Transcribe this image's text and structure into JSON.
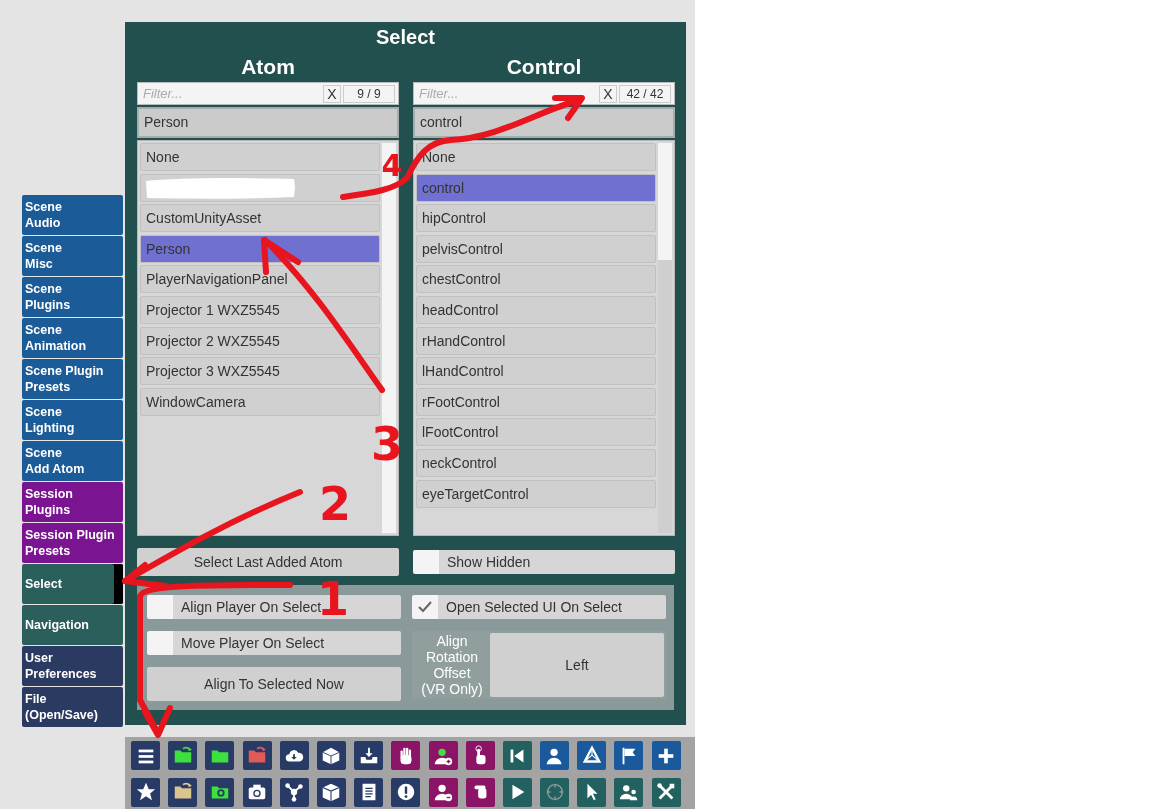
{
  "sidebar": {
    "items": [
      {
        "label": "Scene\nAudio",
        "color": "#1b5b97",
        "selected": false
      },
      {
        "label": "Scene\nMisc",
        "color": "#1b5b97",
        "selected": false
      },
      {
        "label": "Scene\nPlugins",
        "color": "#1b5b97",
        "selected": false
      },
      {
        "label": "Scene\nAnimation",
        "color": "#1b5b97",
        "selected": false
      },
      {
        "label": "Scene Plugin\nPresets",
        "color": "#1b5b97",
        "selected": false
      },
      {
        "label": "Scene\nLighting",
        "color": "#1b5b97",
        "selected": false
      },
      {
        "label": "Scene\nAdd Atom",
        "color": "#1b5b97",
        "selected": false
      },
      {
        "label": "Session\nPlugins",
        "color": "#7a1490",
        "selected": false
      },
      {
        "label": "Session Plugin\nPresets",
        "color": "#7a1490",
        "selected": false
      },
      {
        "label": "Select",
        "color": "#2a5f5b",
        "selected": true
      },
      {
        "label": "Navigation",
        "color": "#2a5f5b",
        "selected": false
      },
      {
        "label": "User\nPreferences",
        "color": "#2a3a60",
        "selected": false
      },
      {
        "label": "File\n(Open/Save)",
        "color": "#2a3a60",
        "selected": false
      }
    ]
  },
  "panel": {
    "title": "Select",
    "columns": [
      {
        "heading": "Atom",
        "filter": {
          "placeholder": "Filter...",
          "clear": "X",
          "count": "9 / 9"
        },
        "current": "Person",
        "items": [
          {
            "kind": "item",
            "label": "None",
            "selected": false
          },
          {
            "kind": "redacted",
            "selected": false
          },
          {
            "kind": "item",
            "label": "CustomUnityAsset",
            "selected": false
          },
          {
            "kind": "item",
            "label": "Person",
            "selected": true
          },
          {
            "kind": "item",
            "label": "PlayerNavigationPanel",
            "selected": false
          },
          {
            "kind": "item",
            "label": "Projector 1 WXZ5545",
            "selected": false
          },
          {
            "kind": "item",
            "label": "Projector 2 WXZ5545",
            "selected": false
          },
          {
            "kind": "item",
            "label": "Projector 3 WXZ5545",
            "selected": false
          },
          {
            "kind": "item",
            "label": "WindowCamera",
            "selected": false
          }
        ]
      },
      {
        "heading": "Control",
        "filter": {
          "placeholder": "Filter...",
          "clear": "X",
          "count": "42 / 42"
        },
        "current": "control",
        "items": [
          {
            "kind": "item",
            "label": "None",
            "selected": false
          },
          {
            "kind": "item",
            "label": "control",
            "selected": true
          },
          {
            "kind": "item",
            "label": "hipControl",
            "selected": false
          },
          {
            "kind": "item",
            "label": "pelvisControl",
            "selected": false
          },
          {
            "kind": "item",
            "label": "chestControl",
            "selected": false
          },
          {
            "kind": "item",
            "label": "headControl",
            "selected": false
          },
          {
            "kind": "item",
            "label": "rHandControl",
            "selected": false
          },
          {
            "kind": "item",
            "label": "lHandControl",
            "selected": false
          },
          {
            "kind": "item",
            "label": "rFootControl",
            "selected": false
          },
          {
            "kind": "item",
            "label": "lFootControl",
            "selected": false
          },
          {
            "kind": "item",
            "label": "neckControl",
            "selected": false
          },
          {
            "kind": "item",
            "label": "eyeTargetControl",
            "selected": false
          }
        ]
      }
    ],
    "select_last_button": "Select Last Added Atom",
    "show_hidden": {
      "label": "Show Hidden",
      "checked": false
    },
    "options": {
      "align_player": {
        "label": "Align Player On Select",
        "checked": false
      },
      "move_player": {
        "label": "Move Player On Select",
        "checked": false
      },
      "align_now_button": "Align To Selected Now",
      "open_ui": {
        "label": "Open Selected UI On Select",
        "checked": true
      },
      "rotation_offset": {
        "label": "Align\nRotation\nOffset\n(VR Only)",
        "value": "Left"
      }
    }
  },
  "toolbar": {
    "rows": [
      [
        {
          "color": "#283a66"
        },
        {
          "color": "#283a66"
        },
        {
          "color": "#283a66"
        },
        {
          "color": "#283a66"
        },
        {
          "color": "#283a66"
        },
        {
          "color": "#283a66"
        },
        {
          "color": "#283a66"
        },
        {
          "color": "#8c1466"
        },
        {
          "color": "#8c1466"
        },
        {
          "color": "#8c1466"
        },
        {
          "color": "#236060"
        },
        {
          "color": "#1a5a9c"
        },
        {
          "color": "#1a5a9c"
        },
        {
          "color": "#1a5a9c"
        },
        {
          "color": "#1a5a9c"
        }
      ],
      [
        {
          "color": "#283a66"
        },
        {
          "color": "#283a66"
        },
        {
          "color": "#283a66"
        },
        {
          "color": "#283a66"
        },
        {
          "color": "#283a66"
        },
        {
          "color": "#283a66"
        },
        {
          "color": "#283a66"
        },
        {
          "color": "#283a66"
        },
        {
          "color": "#8c1466"
        },
        {
          "color": "#8c1466"
        },
        {
          "color": "#236060"
        },
        {
          "color": "#236060"
        },
        {
          "color": "#236060"
        },
        {
          "color": "#236060"
        },
        {
          "color": "#236060"
        }
      ]
    ]
  },
  "annotations": [
    {
      "label": "4"
    },
    {
      "label": "3"
    },
    {
      "label": "2"
    },
    {
      "label": "1"
    }
  ]
}
